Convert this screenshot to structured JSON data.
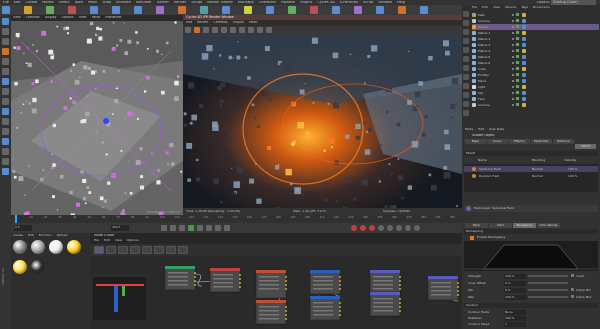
{
  "app": {
    "layout_label": "Layout:",
    "layout_value": "Startup (User)",
    "logo_text": "CINEMA 4D"
  },
  "main_menu": [
    "File",
    "Edit",
    "Create",
    "Modes",
    "Select",
    "Tools",
    "Mesh",
    "Snap",
    "Animate",
    "Simulate",
    "Tracker",
    "Render",
    "Sculpt",
    "Motion Tracker",
    "MoGraph",
    "Character",
    "Pipeline",
    "Plugins",
    "Cycles 4D",
    "X-Particles",
    "Script",
    "Window",
    "Help"
  ],
  "viewport": {
    "menu": [
      "View",
      "Cameras",
      "Display",
      "Options",
      "Filter",
      "Panel",
      "ProRender"
    ],
    "label": "Perspective",
    "status": "Grid Spacing : 100 cm"
  },
  "render_view": {
    "title": "Cycles 4D IPR Render Window",
    "menu": [
      "Edit",
      "Render",
      "Cameras",
      "Output",
      "Panel"
    ],
    "status_left": "Time: 1:16:08 (Rendering : 1:52:35)",
    "status_mid": "Mem: 1.2G (RT: 3.0 Fr)",
    "status_right": "Samples: 74/1000"
  },
  "timeline": {
    "frames": [
      "0",
      "10",
      "20",
      "30",
      "40",
      "50",
      "60",
      "70",
      "80",
      "90",
      "100",
      "110",
      "120",
      "130",
      "140",
      "150",
      "160",
      "170",
      "180",
      "190",
      "200",
      "210",
      "220",
      "230",
      "240",
      "250",
      "260",
      "270",
      "280",
      "290",
      "300"
    ],
    "current": "0 F",
    "end": "300 F"
  },
  "material_manager": {
    "menu": [
      "Create",
      "Edit",
      "Function",
      "Texture"
    ]
  },
  "node_editor": {
    "title": "Node Editor",
    "menu": [
      "File",
      "Edit",
      "View",
      "Options"
    ]
  },
  "object_manager": {
    "menu": [
      "File",
      "Edit",
      "View",
      "Objects",
      "Tags",
      "Bookmarks"
    ],
    "objects": [
      {
        "name": "Main",
        "color": "#8fb36a"
      },
      {
        "name": "Camera",
        "color": "#c8c8c8"
      },
      {
        "name": "Shader",
        "color": "#f0a020"
      },
      {
        "name": "Matrix.1",
        "color": "#8ab4d8"
      },
      {
        "name": "Matrix.2",
        "color": "#8ab4d8"
      },
      {
        "name": "Matrix.3",
        "color": "#8ab4d8"
      },
      {
        "name": "Matrix.4",
        "color": "#8ab4d8"
      },
      {
        "name": "Matrix.5",
        "color": "#8ab4d8"
      },
      {
        "name": "Matrix.6",
        "color": "#8ab4d8"
      },
      {
        "name": "Cube",
        "color": "#8ab4d8"
      },
      {
        "name": "Emitter",
        "color": "#8ab4d8"
      },
      {
        "name": "Plane",
        "color": "#8ab4d8"
      },
      {
        "name": "Light",
        "color": "#e0e0e0"
      },
      {
        "name": "Sky",
        "color": "#8ab4d8"
      },
      {
        "name": "Floor",
        "color": "#8ab4d8"
      },
      {
        "name": "Camera",
        "color": "#c8c8c8"
      }
    ]
  },
  "attributes": {
    "menu": [
      "Mode",
      "Edit",
      "User Data"
    ],
    "object_title": "Shader Object",
    "tabs": [
      "Basic",
      "Coord.",
      "Effector",
      "Parameter",
      "Deformer",
      "Falloff"
    ],
    "active_tab": "Falloff",
    "section": "Falloff",
    "field_headers": [
      "Name",
      "Blending",
      "Visibility"
    ],
    "fields": [
      {
        "name": "Spherical Field",
        "blend": "Normal",
        "value": "100 %"
      },
      {
        "name": "Random Field",
        "blend": "Normal",
        "value": "100 %"
      }
    ],
    "field_layer_label": "Field Layer: Spherical Field",
    "layer_tabs": [
      "Basic",
      "Field",
      "Remapping",
      "Color Remap"
    ],
    "active_layer_tab": "Remapping",
    "remap_section": "Remapping",
    "enable_label": "Enable Remapping",
    "params": [
      {
        "label": "Strength",
        "value": "100 %",
        "extra": "Invert"
      },
      {
        "label": "Inner Offset",
        "value": "0 %"
      },
      {
        "label": "Min",
        "value": "0 %",
        "extra": "Clamp Min"
      },
      {
        "label": "Max",
        "value": "100 %",
        "extra": "Clamp Max"
      }
    ],
    "contour_section": "Contour",
    "contour_params": [
      {
        "label": "Contour Mode",
        "value": "None"
      },
      {
        "label": "Multiplier",
        "value": "100 %"
      },
      {
        "label": "Contour Steps",
        "value": "1"
      }
    ]
  },
  "colors": {
    "accent": "#e07820",
    "selection": "#6a5a8a",
    "panel": "#3a3a3a",
    "dark": "#262626"
  }
}
